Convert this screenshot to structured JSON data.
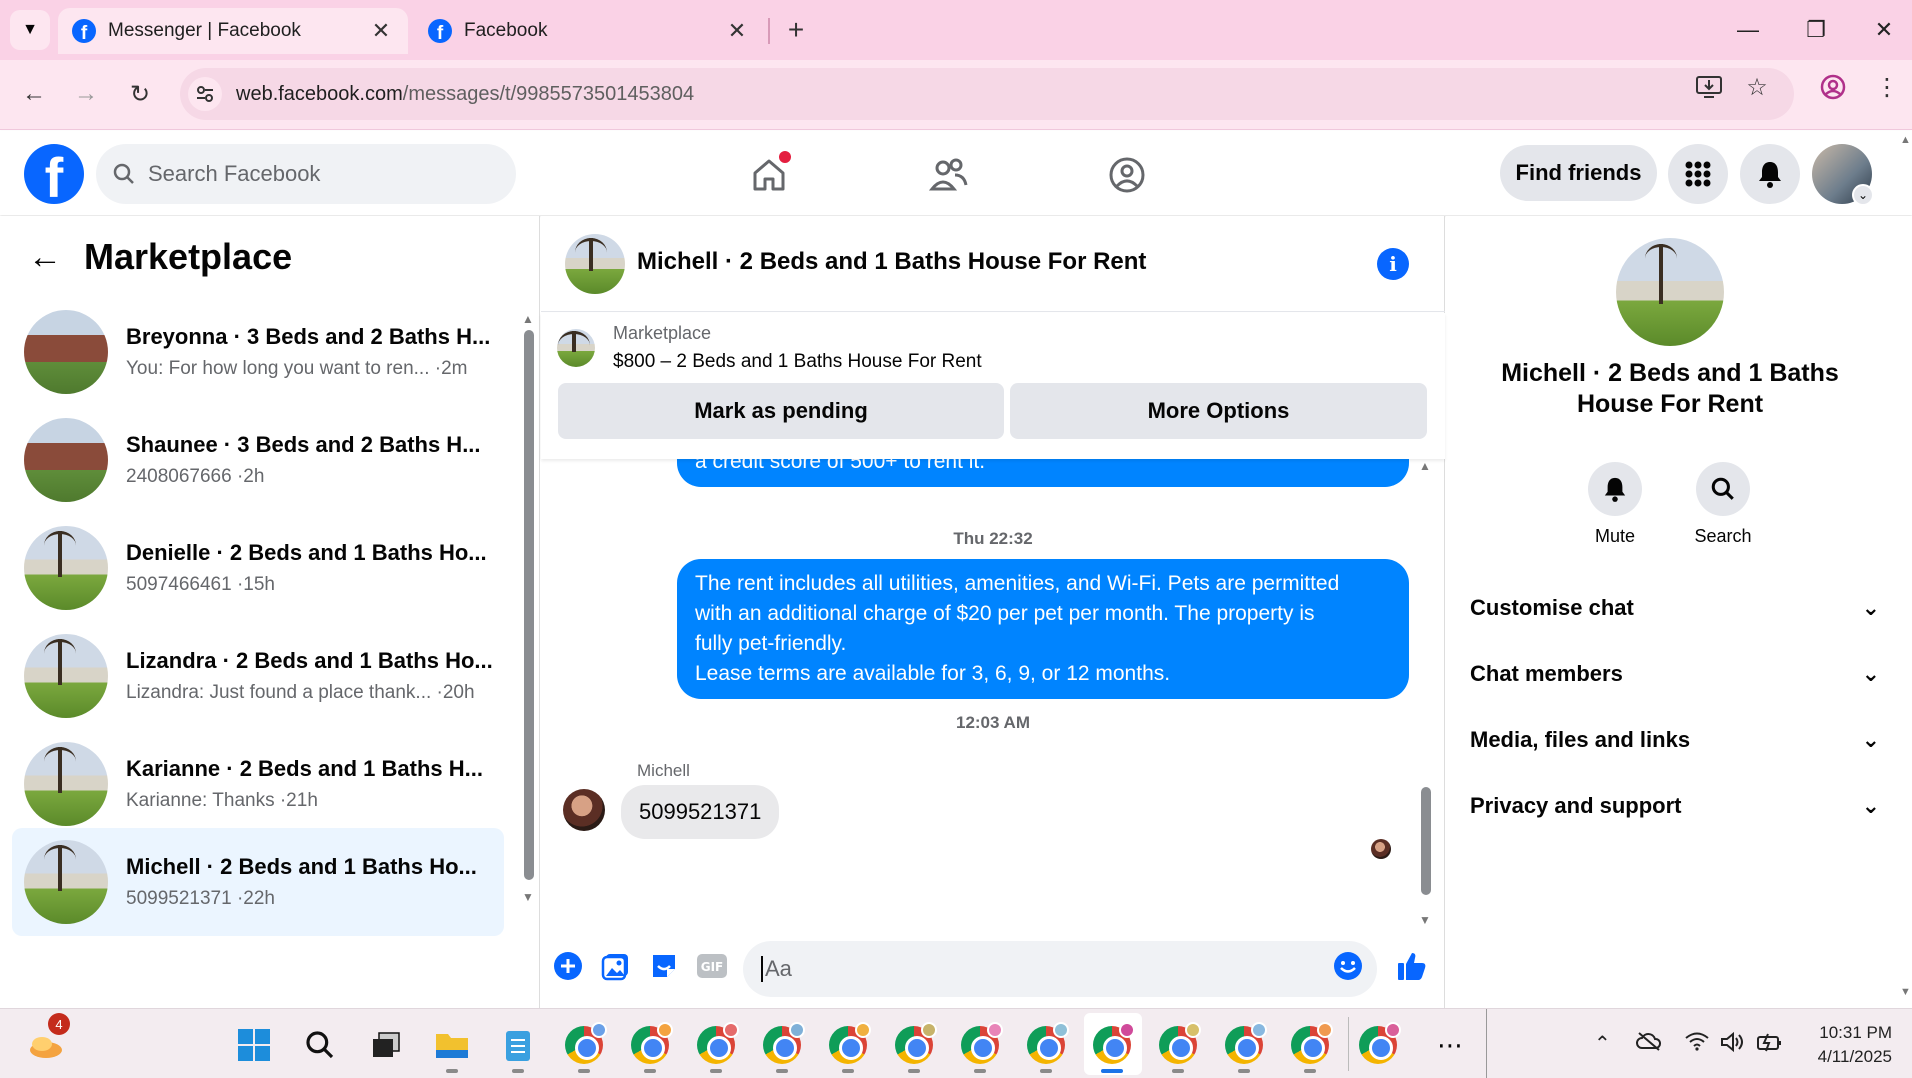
{
  "browser": {
    "tabs": [
      {
        "title": "Messenger | Facebook",
        "active": true
      },
      {
        "title": "Facebook",
        "active": false
      }
    ],
    "url_host": "web.facebook.com",
    "url_path": "/messages/t/9985573501453804"
  },
  "fb": {
    "search_placeholder": "Search Facebook",
    "find_friends": "Find friends"
  },
  "left": {
    "title": "Marketplace",
    "conversations": [
      {
        "name": "Breyonna · 3 Beds and 2 Baths H...",
        "sub": "You: For how long you want to ren... ·2m",
        "active": false
      },
      {
        "name": "Shaunee · 3 Beds and 2 Baths H...",
        "sub": "2408067666 ·2h",
        "active": false
      },
      {
        "name": "Denielle · 2 Beds and 1 Baths Ho...",
        "sub": "5097466461 ·15h",
        "active": false
      },
      {
        "name": "Lizandra · 2 Beds and 1 Baths Ho...",
        "sub": "Lizandra: Just found a place thank... ·20h",
        "active": false
      },
      {
        "name": "Karianne · 2 Beds and 1 Baths H...",
        "sub": "Karianne: Thanks ·21h",
        "active": false
      },
      {
        "name": "Michell · 2 Beds and 1 Baths Ho...",
        "sub": "5099521371 ·22h",
        "active": true
      }
    ]
  },
  "chat": {
    "title": "Michell · 2 Beds and 1 Baths House For Rent",
    "listing_label": "Marketplace",
    "listing_title": "$800 – 2 Beds and 1 Baths House For Rent",
    "mark_pending": "Mark as pending",
    "more_options": "More Options",
    "msg_partial": "a credit score of 500+ to rent it.",
    "stamp1": "Thu 22:32",
    "msg_rent_lines": [
      "The rent includes all utilities, amenities, and Wi-Fi. Pets are permitted",
      "with an additional charge of $20 per pet per month. The property is",
      "fully pet-friendly.",
      "Lease terms are available for 3, 6, 9, or 12 months."
    ],
    "stamp2": "12:03 AM",
    "sender": "Michell",
    "msg_phone": "5099521371",
    "input_placeholder": "Aa"
  },
  "right": {
    "name_line1": "Michell · 2 Beds and 1 Baths",
    "name_line2": "House For Rent",
    "mute": "Mute",
    "search": "Search",
    "sections": [
      "Customise chat",
      "Chat members",
      "Media, files and links",
      "Privacy and support"
    ]
  },
  "taskbar": {
    "badge": "4",
    "time": "10:31 PM",
    "date": "4/11/2025"
  },
  "colors": {
    "fb_blue": "#0866ff",
    "bubble_blue": "#0084ff",
    "browser_pink": "#fad2e6"
  }
}
